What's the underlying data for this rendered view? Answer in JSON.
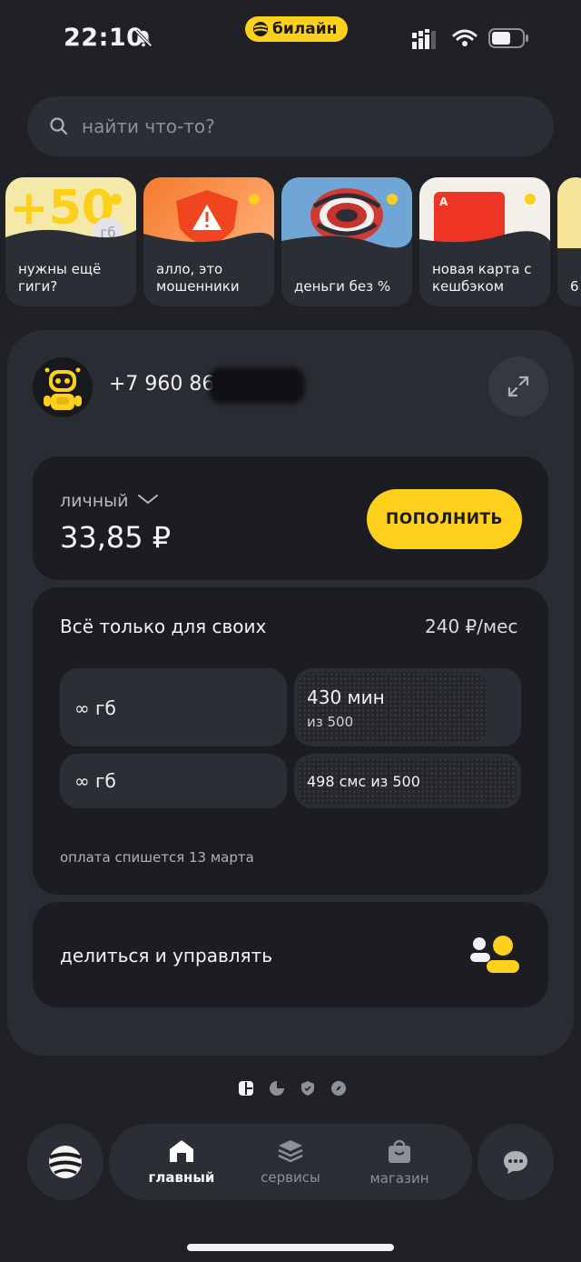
{
  "status_bar": {
    "time": "22:10",
    "carrier": "билайн"
  },
  "search": {
    "placeholder": "найти что-то?"
  },
  "stories": [
    {
      "label": "нужны ещё гиги?",
      "badge_big": "+50",
      "badge_unit": "гб"
    },
    {
      "label": "алло, это мошенники"
    },
    {
      "label": "деньги без %"
    },
    {
      "label": "новая карта с кешбэком"
    },
    {
      "label": "6"
    }
  ],
  "account": {
    "phone": "+7 960 868",
    "label": "личный",
    "balance": "33,85 ₽",
    "topup_label": "ПОПОЛНИТЬ"
  },
  "tariff": {
    "name": "Всё только для своих",
    "price": "240 ₽/мес",
    "tiles": {
      "internet_1": "∞ гб",
      "internet_2": "∞ гб",
      "minutes_main": "430 мин",
      "minutes_sub": "из 500",
      "minutes_fraction": 0.86,
      "sms": "498 смс из 500",
      "sms_fraction": 0.996
    },
    "payment_note": "оплата спишется 13 марта"
  },
  "share": {
    "label": "делиться и управлять"
  },
  "nav": {
    "home": "главный",
    "services": "сервисы",
    "shop": "магазин"
  },
  "colors": {
    "accent": "#fdd01c",
    "background": "#1f2127",
    "card": "#2a2c33",
    "inner_card": "#1c1d22"
  }
}
